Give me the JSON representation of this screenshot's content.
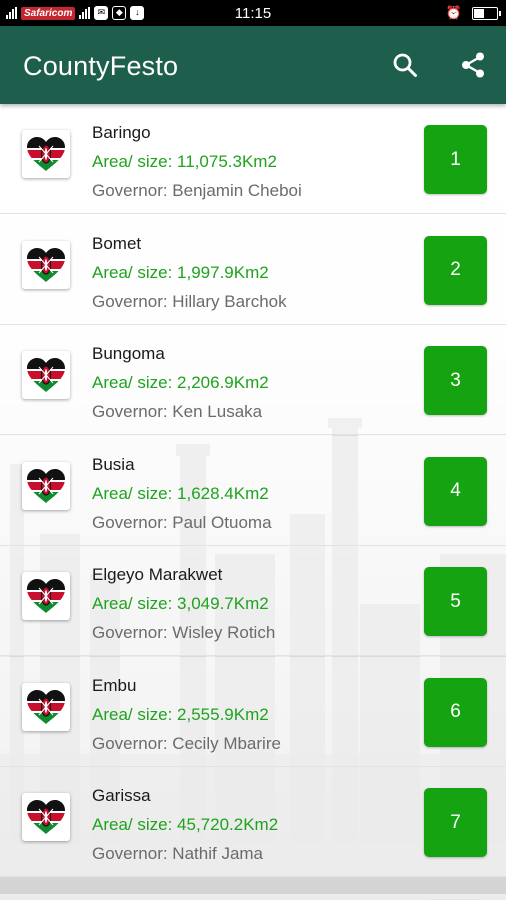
{
  "status_bar": {
    "carrier": "Safaricom",
    "time": "11:15",
    "icons": [
      "signal-icon",
      "message-icon",
      "shield-icon",
      "download-icon",
      "alarm-icon",
      "battery-icon"
    ]
  },
  "app_bar": {
    "title": "CountyFesto",
    "color": "#1e5e4c",
    "actions": [
      "search-icon",
      "share-icon"
    ]
  },
  "list": {
    "accent_green": "#16a312",
    "area_color": "#1fa31f",
    "items": [
      {
        "index": "1",
        "name": "Baringo",
        "area": "Area/ size: 11,075.3Km2",
        "governor": "Governor: Benjamin Cheboi"
      },
      {
        "index": "2",
        "name": "Bomet",
        "area": "Area/ size: 1,997.9Km2",
        "governor": "Governor: Hillary Barchok"
      },
      {
        "index": "3",
        "name": "Bungoma",
        "area": "Area/ size: 2,206.9Km2",
        "governor": "Governor: Ken Lusaka"
      },
      {
        "index": "4",
        "name": "Busia",
        "area": "Area/ size: 1,628.4Km2",
        "governor": "Governor: Paul Otuoma"
      },
      {
        "index": "5",
        "name": "Elgeyo Marakwet",
        "area": "Area/ size: 3,049.7Km2",
        "governor": "Governor: Wisley Rotich"
      },
      {
        "index": "6",
        "name": "Embu",
        "area": "Area/ size: 2,555.9Km2",
        "governor": "Governor: Cecily Mbarire"
      },
      {
        "index": "7",
        "name": "Garissa",
        "area": "Area/ size: 45,720.2Km2",
        "governor": "Governor: Nathif Jama"
      }
    ]
  }
}
